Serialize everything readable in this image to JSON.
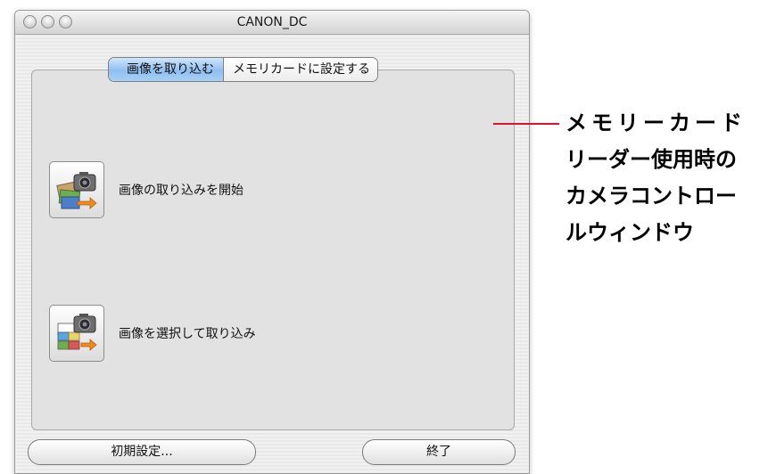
{
  "window": {
    "title": "CANON_DC"
  },
  "tabs": [
    {
      "label": "画像を取り込む",
      "active": true
    },
    {
      "label": "メモリカードに設定する",
      "active": false
    }
  ],
  "actions": [
    {
      "label": "画像の取り込みを開始",
      "icon": "camera-import-icon"
    },
    {
      "label": "画像を選択して取り込み",
      "icon": "camera-select-import-icon"
    }
  ],
  "buttons": {
    "settings": "初期設定...",
    "quit": "終了"
  },
  "callout": {
    "lines": [
      "メモリーカード",
      "リーダー使用時の",
      "カメラコントロー",
      "ルウィンドウ"
    ],
    "line_color": "#e0102e"
  },
  "colors": {
    "tab_active": "#8fbff0",
    "panel": "#e2e2e2"
  }
}
